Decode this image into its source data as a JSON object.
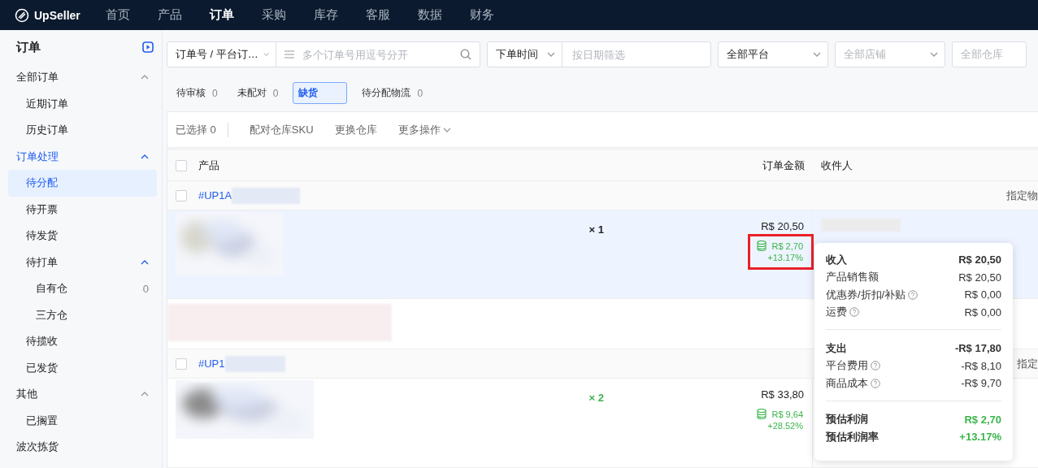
{
  "topnav": {
    "logo": "UpSeller",
    "items": [
      {
        "label": "首页",
        "selected": false
      },
      {
        "label": "产品",
        "selected": false
      },
      {
        "label": "订单",
        "selected": true
      },
      {
        "label": "采购",
        "selected": false
      },
      {
        "label": "库存",
        "selected": false
      },
      {
        "label": "客服",
        "selected": false
      },
      {
        "label": "数据",
        "selected": false
      },
      {
        "label": "财务",
        "selected": false
      }
    ]
  },
  "sidebar": {
    "title": "订单",
    "items": [
      {
        "label": "全部订单",
        "active": false,
        "selected": false,
        "expanded": true,
        "children": [
          {
            "label": "近期订单",
            "selected": false
          },
          {
            "label": "历史订单",
            "selected": false
          }
        ]
      },
      {
        "label": "订单处理",
        "active": true,
        "selected": false,
        "expanded": true,
        "children": [
          {
            "label": "待分配",
            "selected": true
          },
          {
            "label": "待开票",
            "selected": false
          },
          {
            "label": "待发货",
            "selected": false
          },
          {
            "label": "待打单",
            "selected": false,
            "expanded": true,
            "children": [
              {
                "label": "自有仓",
                "selected": false,
                "count": "0"
              },
              {
                "label": "三方仓",
                "selected": false
              }
            ]
          },
          {
            "label": "待揽收",
            "selected": false
          },
          {
            "label": "已发货",
            "selected": false
          }
        ]
      },
      {
        "label": "其他",
        "active": false,
        "selected": false,
        "expanded": true,
        "children": [
          {
            "label": "已搁置",
            "selected": false
          }
        ]
      },
      {
        "label": "波次拣货",
        "active": false,
        "selected": false
      }
    ]
  },
  "filters": {
    "search_type": "订单号 / 平台订…",
    "search_placeholder": "多个订单号用逗号分开",
    "time_type": "下单时间",
    "date_placeholder": "按日期筛选",
    "platform": "全部平台",
    "shop_placeholder": "全部店铺",
    "warehouse_placeholder": "全部仓库"
  },
  "status_tabs": [
    {
      "label": "待审核",
      "count": "0",
      "selected": false
    },
    {
      "label": "未配对",
      "count": "0",
      "selected": false
    },
    {
      "label": "缺货",
      "selected": true
    },
    {
      "label": "待分配物流",
      "count": "0",
      "selected": false
    }
  ],
  "toolbar": {
    "selected_count": "已选择 0",
    "actions": [
      {
        "label": "配对仓库SKU",
        "dropdown": false
      },
      {
        "label": "更换仓库",
        "dropdown": false
      },
      {
        "label": "更多操作",
        "dropdown": true
      }
    ]
  },
  "table": {
    "columns": [
      "产品",
      "订单金额",
      "收件人"
    ],
    "all_checked": false,
    "orders": [
      {
        "id": "#UP1A",
        "action": "指定物",
        "checked": false,
        "hovered": true,
        "qty": "× 1",
        "qty_highlight": false,
        "amount": "R$ 20,50",
        "profit": "R$ 2,70",
        "profit_rate": "+13.17%",
        "extra_row": true,
        "profit_marked": true
      },
      {
        "id": "#UP1",
        "action": "指定",
        "checked": false,
        "hovered": false,
        "qty": "× 2",
        "qty_highlight": true,
        "amount": "R$ 33,80",
        "profit": "R$ 9,64",
        "profit_rate": "+28.52%",
        "extra_row": false,
        "profit_marked": false
      }
    ]
  },
  "profit_popover": {
    "sections": [
      {
        "rows": [
          {
            "kind": "heading",
            "label": "收入",
            "value": "R$ 20,50"
          },
          {
            "kind": "item",
            "label": "产品销售额",
            "value": "R$ 20,50",
            "help": false
          },
          {
            "kind": "item",
            "label": "优惠券/折扣/补贴",
            "value": "R$ 0,00",
            "help": true
          },
          {
            "kind": "item",
            "label": "运费",
            "value": "R$ 0,00",
            "help": true
          }
        ]
      },
      {
        "rows": [
          {
            "kind": "heading",
            "label": "支出",
            "value": "-R$ 17,80"
          },
          {
            "kind": "item",
            "label": "平台费用",
            "value": "-R$ 8,10",
            "help": true
          },
          {
            "kind": "item",
            "label": "商品成本",
            "value": "-R$ 9,70",
            "help": true
          }
        ]
      },
      {
        "rows": [
          {
            "kind": "result",
            "label": "预估利润",
            "value": "R$ 2,70"
          },
          {
            "kind": "result",
            "label": "预估利润率",
            "value": "+13.17%"
          }
        ]
      }
    ]
  }
}
